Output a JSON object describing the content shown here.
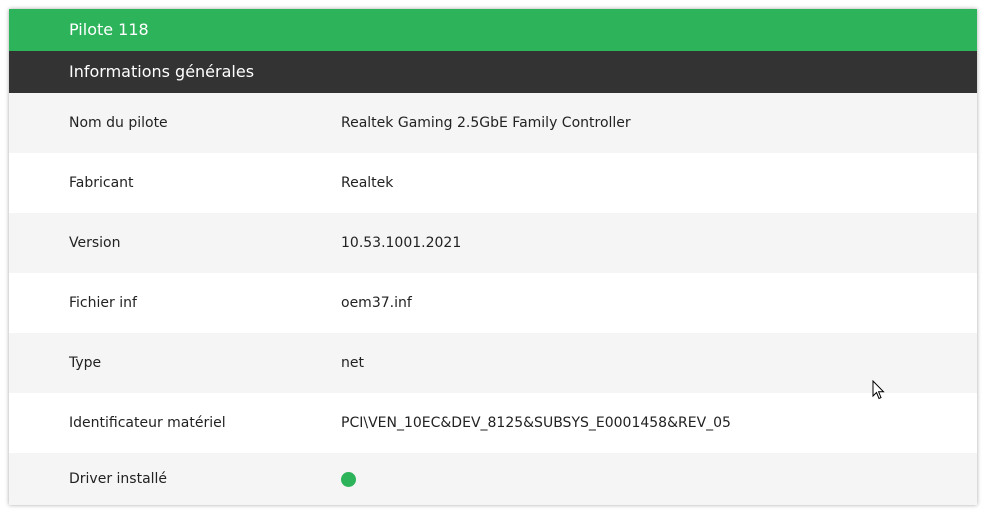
{
  "header": {
    "title": "Pilote 118"
  },
  "section": {
    "title": "Informations générales"
  },
  "rows": [
    {
      "label": "Nom du pilote",
      "value": "Realtek Gaming 2.5GbE Family Controller"
    },
    {
      "label": "Fabricant",
      "value": "Realtek"
    },
    {
      "label": "Version",
      "value": "10.53.1001.2021"
    },
    {
      "label": "Fichier inf",
      "value": "oem37.inf"
    },
    {
      "label": "Type",
      "value": "net"
    },
    {
      "label": "Identificateur matériel",
      "value": "PCI\\VEN_10EC&DEV_8125&SUBSYS_E0001458&REV_05"
    },
    {
      "label": "Driver installé",
      "status_icon": "green-dot-icon",
      "installed": true
    }
  ],
  "colors": {
    "accent": "#2db35a",
    "section_bg": "#333333",
    "row_alt": "#f5f5f5"
  }
}
